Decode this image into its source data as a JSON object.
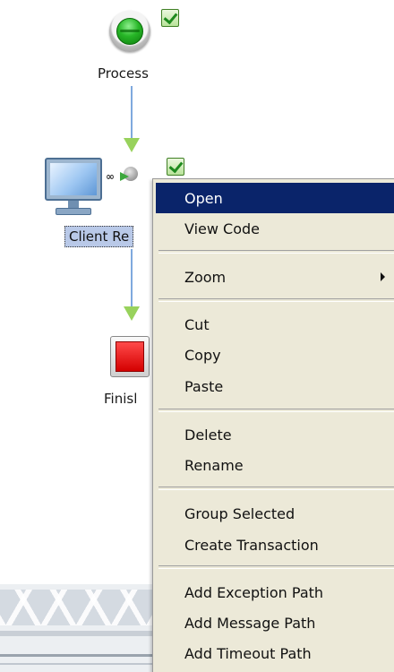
{
  "diagram": {
    "nodes": [
      {
        "id": "start",
        "label": "Process"
      },
      {
        "id": "client",
        "label": "Client Re"
      },
      {
        "id": "finish",
        "label": "Finisl"
      }
    ]
  },
  "context_menu": {
    "items": [
      {
        "label": "Open",
        "active": true
      },
      {
        "label": "View Code"
      },
      {
        "label": "Zoom",
        "submenu": true
      },
      {
        "label": "Cut"
      },
      {
        "label": "Copy"
      },
      {
        "label": "Paste"
      },
      {
        "label": "Delete"
      },
      {
        "label": "Rename"
      },
      {
        "label": "Group Selected"
      },
      {
        "label": "Create Transaction"
      },
      {
        "label": "Add Exception Path"
      },
      {
        "label": "Add Message Path"
      },
      {
        "label": "Add Timeout Path"
      }
    ]
  },
  "colors": {
    "menu_background": "#ece9d8",
    "menu_highlight": "#0a246a",
    "connector": "#7fa9de",
    "arrow": "#98d25c",
    "start_node": "#27b627",
    "end_node": "#d40000",
    "selection": "#b9c9e8"
  },
  "icons": {
    "start": "green-circle-start-icon",
    "status": "green-check-icon",
    "client": "monitor-icon",
    "web_service": "web-service-arrow-icon",
    "finish": "red-square-end-icon"
  }
}
